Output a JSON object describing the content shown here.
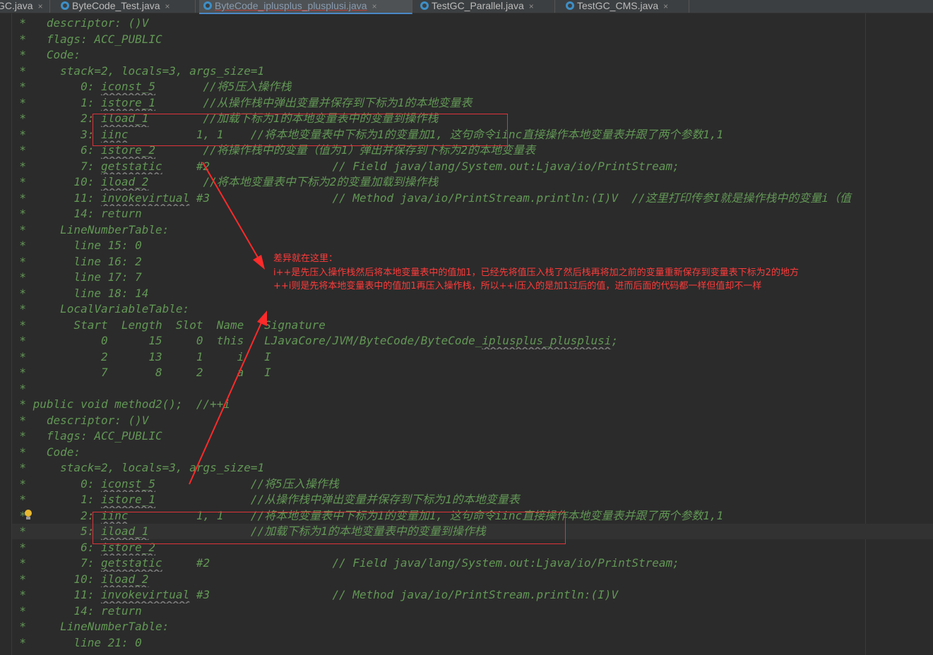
{
  "tabs": [
    {
      "label": "GC.java",
      "active": false
    },
    {
      "label": "ByteCode_Test.java",
      "active": false
    },
    {
      "label": "ByteCode_iplusplus_plusplusi.java",
      "active": true
    },
    {
      "label": "TestGC_Parallel.java",
      "active": false
    },
    {
      "label": "TestGC_CMS.java",
      "active": false
    }
  ],
  "close_glyph": "×",
  "colors": {
    "background": "#2b2b2b",
    "comment": "#629755",
    "annotation": "#ff3b3b",
    "tab_bar": "#3c3f41"
  },
  "code_lines": [
    {
      "text": "   descriptor: ()V"
    },
    {
      "text": "   flags: ACC_PUBLIC"
    },
    {
      "text": "   Code:"
    },
    {
      "text": "     stack=2, locals=3, args_size=1"
    },
    {
      "text": "        0: iconst_5       //将5压入操作栈",
      "squiggle": "iconst_5"
    },
    {
      "text": "        1: istore_1       //从操作栈中弹出变量并保存到下标为1的本地变量表",
      "squiggle": "istore_1"
    },
    {
      "text": "        2: iload_1        //加载下标为1的本地变量表中的变量到操作栈",
      "squiggle": "iload_1"
    },
    {
      "text": "        3: iinc          1, 1    //将本地变量表中下标为1的变量加1, 这句命令iinc直接操作本地变量表并跟了两个参数1,1",
      "squiggle": "iinc"
    },
    {
      "text": "        6: istore_2       //将操作栈中的变量（值为1）弹出并保存到下标为2的本地变量表",
      "squiggle": "istore_2"
    },
    {
      "text": "        7: getstatic     #2                  // Field java/lang/System.out:Ljava/io/PrintStream;",
      "squiggle": "getstatic"
    },
    {
      "text": "       10: iload_2        //将本地变量表中下标为2的变量加载到操作栈",
      "squiggle": "iload_2"
    },
    {
      "text": "       11: invokevirtual #3                  // Method java/io/PrintStream.println:(I)V  //这里打印传参I就是操作栈中的变量i（值",
      "squiggle": "invokevirtual"
    },
    {
      "text": "       14: return"
    },
    {
      "text": "     LineNumberTable:"
    },
    {
      "text": "       line 15: 0"
    },
    {
      "text": "       line 16: 2"
    },
    {
      "text": "       line 17: 7"
    },
    {
      "text": "       line 18: 14"
    },
    {
      "text": "     LocalVariableTable:"
    },
    {
      "text": "       Start  Length  Slot  Name   Signature"
    },
    {
      "text": "           0      15     0  this   LJavaCore/JVM/ByteCode/ByteCode_iplusplus_plusplusi;",
      "squiggle": "iplusplus_plusplusi"
    },
    {
      "text": "           2      13     1     i   I"
    },
    {
      "text": "           7       8     2     a   I"
    },
    {
      "text": ""
    },
    {
      "text": " public void method2();  //++i"
    },
    {
      "text": "   descriptor: ()V"
    },
    {
      "text": "   flags: ACC_PUBLIC"
    },
    {
      "text": "   Code:"
    },
    {
      "text": "     stack=2, locals=3, args_size=1"
    },
    {
      "text": "        0: iconst_5              //将5压入操作栈",
      "squiggle": "iconst_5"
    },
    {
      "text": "        1: istore_1              //从操作栈中弹出变量并保存到下标为1的本地变量表",
      "squiggle": "istore_1"
    },
    {
      "text": "        2: iinc          1, 1    //将本地变量表中下标为1的变量加1, 这句命令iinc直接操作本地变量表并跟了两个参数1,1",
      "squiggle": "iinc"
    },
    {
      "text": "        5: iload_1               //加载下标为1的本地变量表中的变量到操作栈",
      "squiggle": "iload_1"
    },
    {
      "text": "        6: istore_2",
      "squiggle": "istore_2"
    },
    {
      "text": "        7: getstatic     #2                  // Field java/lang/System.out:Ljava/io/PrintStream;",
      "squiggle": "getstatic"
    },
    {
      "text": "       10: iload_2",
      "squiggle": "iload_2"
    },
    {
      "text": "       11: invokevirtual #3                  // Method java/io/PrintStream.println:(I)V",
      "squiggle": "invokevirtual"
    },
    {
      "text": "       14: return"
    },
    {
      "text": "     LineNumberTable:"
    },
    {
      "text": "       line 21: 0"
    }
  ],
  "annotation": {
    "line1": "差异就在这里：",
    "line2": "i++是先压入操作栈然后将本地变量表中的值加1，已经先将值压入栈了然后栈再将加之前的变量重新保存到变量表下标为2的地方",
    "line3": "++i则是先将本地变量表中的值加1再压入操作栈，所以++i压入的是加1过后的值，进而后面的代码都一样但值却不一样"
  },
  "gutter_marker": "*"
}
